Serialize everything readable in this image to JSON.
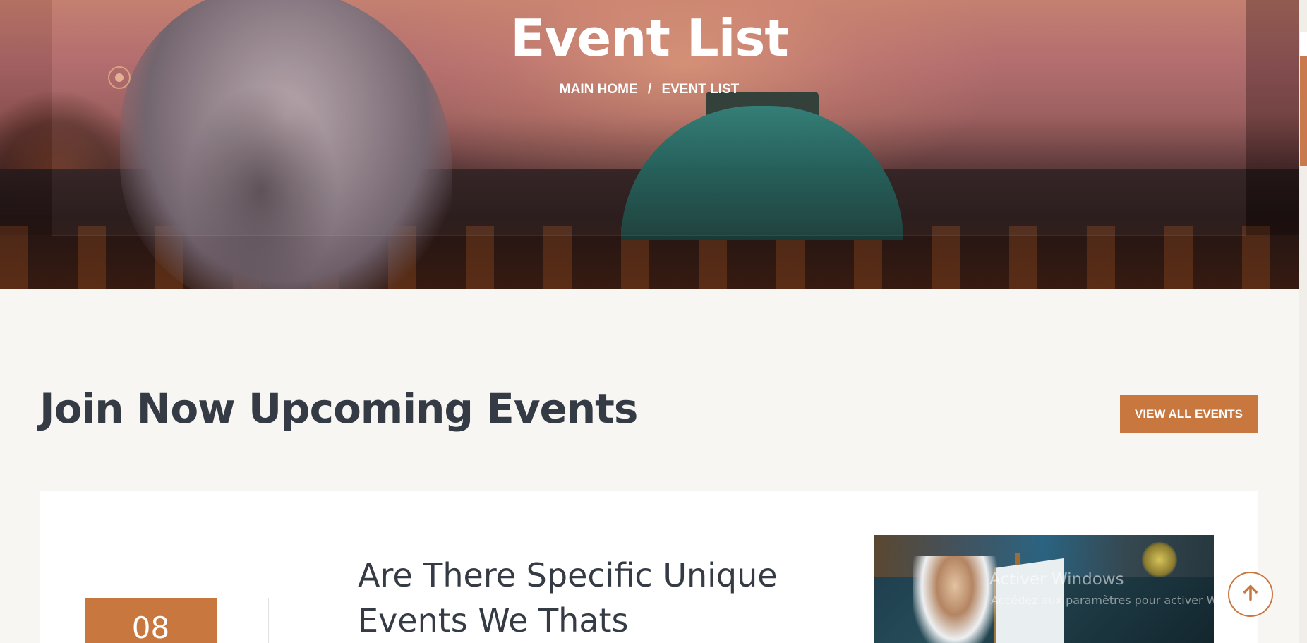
{
  "hero": {
    "title": "Event List",
    "breadcrumb": {
      "home": "MAIN HOME",
      "separator": "/",
      "current": "EVENT LIST"
    }
  },
  "section": {
    "title": "Join Now Upcoming Events",
    "view_all_label": "VIEW ALL EVENTS"
  },
  "event": {
    "date_day": "08",
    "title": "Are There Specific Unique Events We Thats"
  },
  "watermark": {
    "title": "Activer Windows",
    "subtitle": "Accédez aux paramètres pour activer Windows."
  },
  "icons": {
    "back_to_top": "arrow-up-icon",
    "slider": "slider-dot-icon"
  },
  "colors": {
    "accent": "#c8773f",
    "page_bg": "#f8f6f2",
    "heading": "#353b45",
    "card_bg": "#ffffff"
  }
}
